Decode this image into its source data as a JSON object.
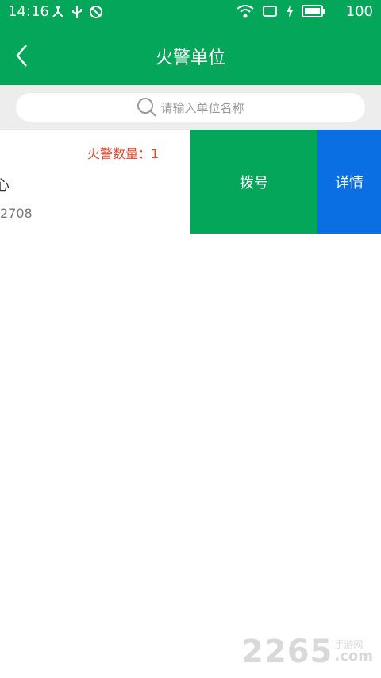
{
  "status_bar": {
    "time": "14:16",
    "battery": "100"
  },
  "header": {
    "title": "火警单位",
    "back_icon": "chevron-left-icon"
  },
  "search": {
    "placeholder": "请输入单位名称",
    "icon": "search-icon"
  },
  "list": {
    "items": [
      {
        "alarm_count_label": "火警数量：1",
        "name": "心",
        "phone": "2708",
        "dial_label": "拨号",
        "details_label": "详情"
      }
    ]
  },
  "watermark": {
    "digits": "2265",
    "site": "手游网",
    "domain": ".com"
  },
  "colors": {
    "primary": "#04a75a",
    "details": "#0a6fe3",
    "alarm": "#e0452e"
  }
}
